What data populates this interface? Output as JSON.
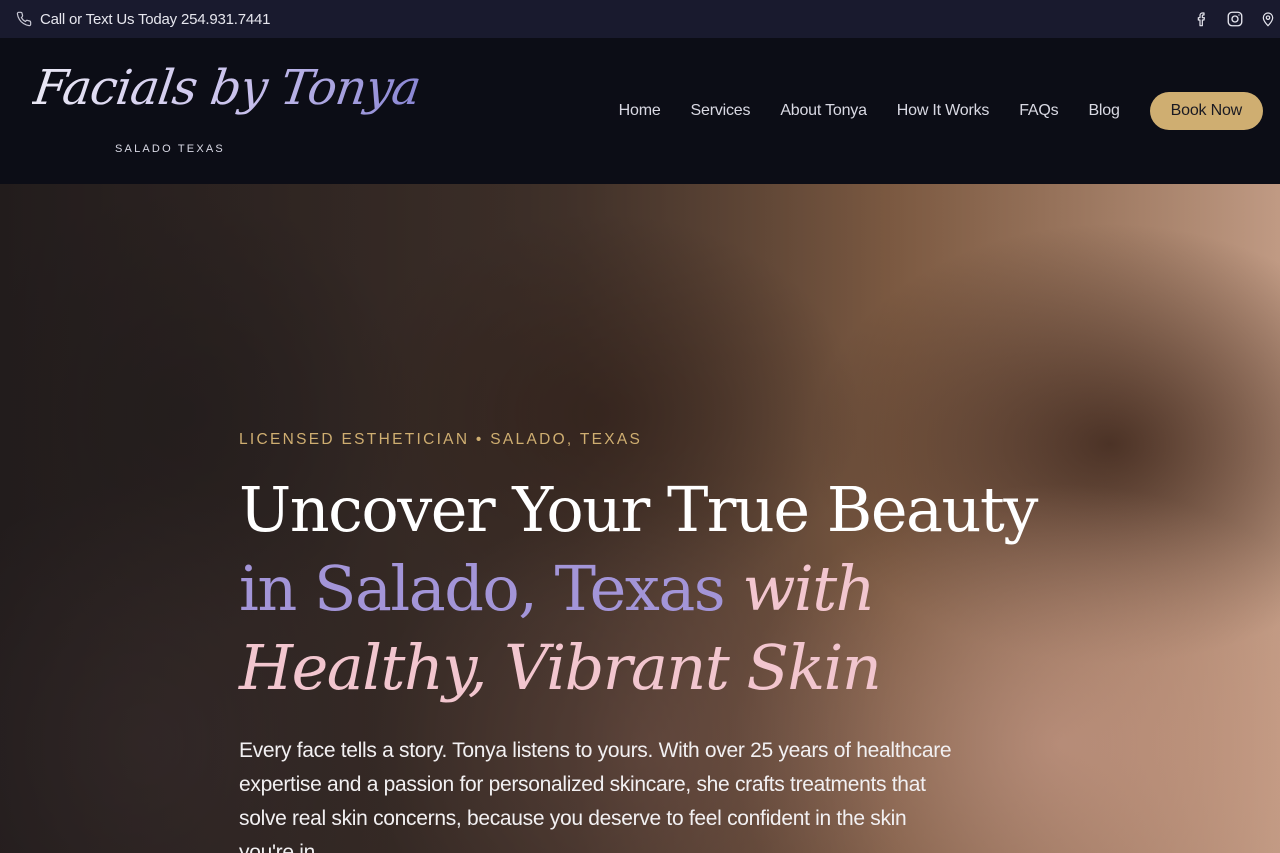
{
  "topbar": {
    "phone_text": "Call or Text Us Today 254.931.7441",
    "social": [
      "facebook-icon",
      "instagram-icon",
      "map-pin-icon"
    ]
  },
  "header": {
    "logo_script": "Facials by Tonya",
    "logo_sub": "SALADO TEXAS",
    "nav": [
      "Home",
      "Services",
      "About Tonya",
      "How It Works",
      "FAQs",
      "Blog"
    ],
    "cta": "Book Now"
  },
  "hero": {
    "eyebrow": "LICENSED ESTHETICIAN • SALADO, TEXAS",
    "line1": "Uncover Your True Beauty",
    "line2_a": "in Salado, Texas",
    "line2_b": "with",
    "line3": "Healthy, Vibrant Skin",
    "lead": "Every face tells a story. Tonya listens to yours. With over 25 years of healthcare expertise and a passion for personalized skincare, she crafts treatments that solve real skin concerns, because you deserve to feel confident in the skin you're in."
  },
  "colors": {
    "topbar_bg": "#191a2e",
    "header_bg": "#0c0d16",
    "gold": "#cfae71",
    "lavender": "#a395d8",
    "pink": "#f2c6cf"
  }
}
